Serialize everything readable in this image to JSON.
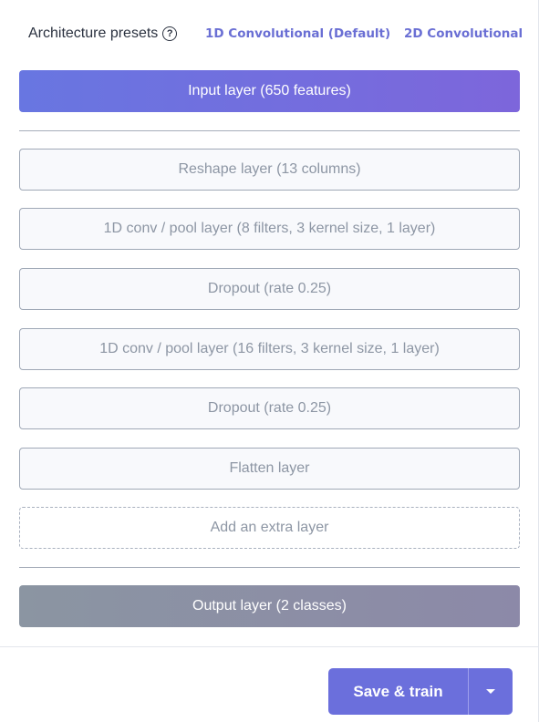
{
  "presets": {
    "title": "Architecture presets",
    "help_glyph": "?",
    "options": [
      "1D Convolutional (Default)",
      "2D Convolutional"
    ]
  },
  "layers": {
    "input": "Input layer (650 features)",
    "items": [
      "Reshape layer (13 columns)",
      "1D conv / pool layer (8 filters, 3 kernel size, 1 layer)",
      "Dropout (rate 0.25)",
      "1D conv / pool layer (16 filters, 3 kernel size, 1 layer)",
      "Dropout (rate 0.25)",
      "Flatten layer"
    ],
    "add_extra": "Add an extra layer",
    "output": "Output layer (2 classes)"
  },
  "actions": {
    "save_train": "Save & train"
  },
  "colors": {
    "accent": "#6b6fdc",
    "input_gradient": [
      "#6876e1",
      "#7d66db"
    ],
    "output_gradient": [
      "#8b95a2",
      "#8c89a8"
    ]
  }
}
